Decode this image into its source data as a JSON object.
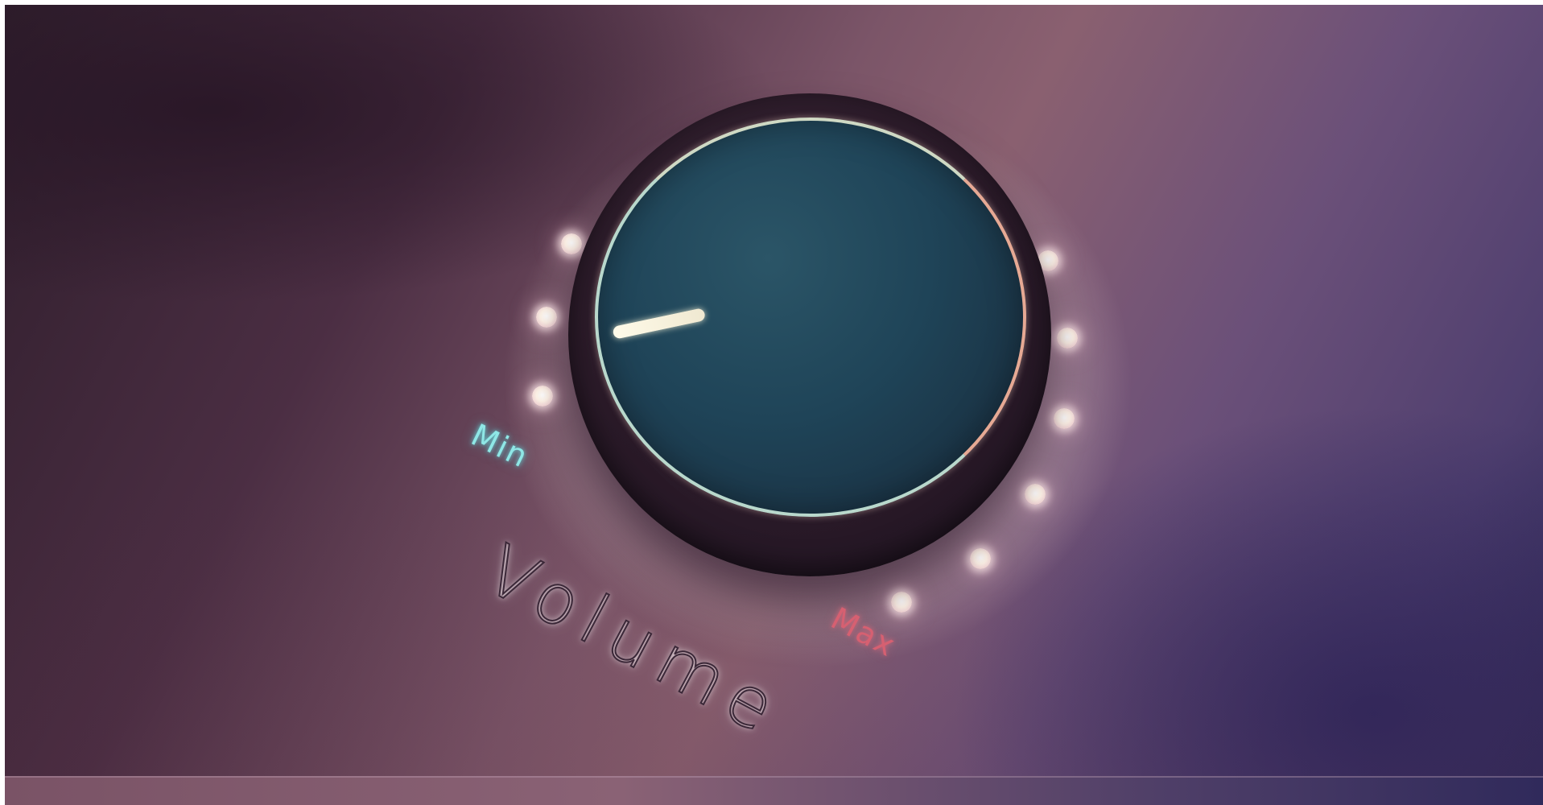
{
  "knob": {
    "label": "Volume",
    "min_label": "Min",
    "max_label": "Max",
    "level_fraction": 0.0,
    "led_count": 10
  },
  "colors": {
    "min_label": "#8fe7e6",
    "max_label": "#d66071",
    "knob_face": "#1f4458",
    "indicator": "#fffbe9",
    "led": "#fff4e8"
  },
  "icons": [
    "knob-indicator-icon",
    "led-dot-icon"
  ]
}
